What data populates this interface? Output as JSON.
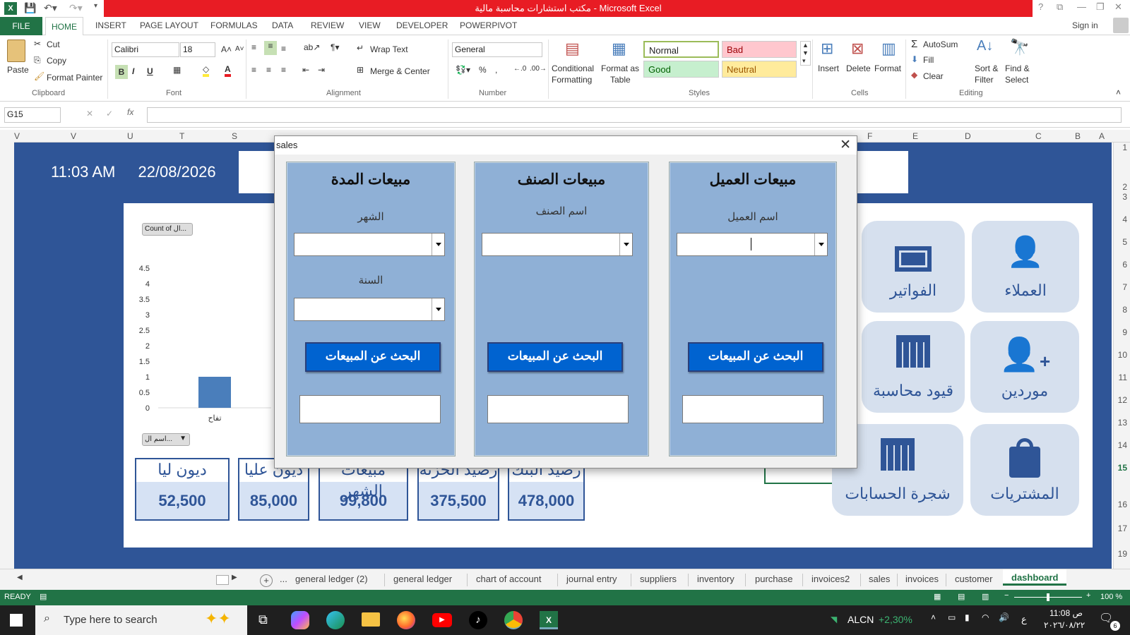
{
  "window": {
    "title": "مكتب استشارات محاسبة مالية - Microsoft Excel",
    "help": "?",
    "sign_in": "Sign in"
  },
  "ribbon_tabs": [
    "FILE",
    "HOME",
    "INSERT",
    "PAGE LAYOUT",
    "FORMULAS",
    "DATA",
    "REVIEW",
    "VIEW",
    "DEVELOPER",
    "POWERPIVOT"
  ],
  "clipboard": {
    "paste": "Paste",
    "cut": "Cut",
    "copy": "Copy",
    "format_painter": "Format Painter",
    "group": "Clipboard"
  },
  "font": {
    "name": "Calibri",
    "size": "18",
    "group": "Font"
  },
  "alignment": {
    "wrap": "Wrap Text",
    "merge": "Merge & Center",
    "group": "Alignment"
  },
  "number": {
    "format": "General",
    "group": "Number"
  },
  "styles": {
    "conditional": "Conditional",
    "formatting": "Formatting",
    "format_as": "Format as",
    "table": "Table",
    "normal": "Normal",
    "bad": "Bad",
    "good": "Good",
    "neutral": "Neutral",
    "group": "Styles"
  },
  "cells": {
    "insert": "Insert",
    "delete": "Delete",
    "format": "Format",
    "group": "Cells"
  },
  "editing": {
    "autosum": "AutoSum",
    "fill": "Fill",
    "clear": "Clear",
    "sort": "Sort &",
    "filter": "Filter",
    "find": "Find &",
    "select": "Select",
    "group": "Editing"
  },
  "formula_bar": {
    "name_box": "G15",
    "formula": ""
  },
  "columns": [
    "V",
    "V",
    "U",
    "T",
    "S",
    "F",
    "E",
    "D",
    "C",
    "B",
    "A"
  ],
  "rows": [
    "1",
    "2",
    "3",
    "4",
    "5",
    "6",
    "7",
    "8",
    "9",
    "10",
    "11",
    "12",
    "13",
    "14",
    "15",
    "16",
    "17",
    "19"
  ],
  "dashboard": {
    "time": "11:03 AM",
    "date": "22/08/2026",
    "chart_button": "Count of ال...",
    "chart_filter": "اسم ال...",
    "kpis": [
      {
        "title": "ديون ليا",
        "value": "52,500"
      },
      {
        "title": "ديون عليا",
        "value": "85,000"
      },
      {
        "title": "مبيعات الشهر",
        "value": "99,800"
      },
      {
        "title": "رصيد الخزنة",
        "value": "375,500"
      },
      {
        "title": "رصيد البنك",
        "value": "478,000"
      }
    ],
    "tiles": {
      "invoices": "الفواتير",
      "customers": "العملاء",
      "journal": "قيود محاسبة",
      "suppliers": "موردين",
      "accounts_tree": "شجرة الحسابات",
      "purchases": "المشتريات"
    }
  },
  "chart_data": {
    "type": "bar",
    "categories": [
      "تفاح"
    ],
    "values": [
      1
    ],
    "ylim": [
      0,
      4.5
    ],
    "yticks": [
      "4.5",
      "4",
      "3.5",
      "3",
      "2.5",
      "2",
      "1.5",
      "1",
      "0.5",
      "0"
    ],
    "color": "#4a7ebb"
  },
  "dialog": {
    "title": "sales",
    "close": "✕",
    "panels": {
      "period": {
        "title": "مبيعات المدة",
        "month_label": "الشهر",
        "year_label": "السنة",
        "button": "البحث عن المبيعات"
      },
      "item": {
        "title": "مبيعات الصنف",
        "item_label": "اسم الصنف",
        "button": "البحث عن المبيعات"
      },
      "customer": {
        "title": "مبيعات العميل",
        "customer_label": "اسم العميل",
        "button": "البحث عن المبيعات"
      }
    }
  },
  "sheet_tabs": [
    "...",
    "general ledger (2)",
    "general ledger",
    "chart of account",
    "journal entry",
    "suppliers",
    "inventory",
    "purchase",
    "invoices2",
    "sales",
    "invoices",
    "customer",
    "dashboard"
  ],
  "status": {
    "ready": "READY",
    "zoom": "100 %"
  },
  "taskbar": {
    "search_placeholder": "Type here to search",
    "stock_name": "ALCN",
    "stock_change": "+2,30%",
    "time": "11:08 ص",
    "date": "٢٠٢٦/٠٨/٢٢",
    "lang": "ع",
    "notif_count": "6"
  },
  "colors": {
    "excel_green": "#217346",
    "title_red": "#e81c24",
    "dash_blue": "#2f5597",
    "button_blue": "#0063d0"
  }
}
